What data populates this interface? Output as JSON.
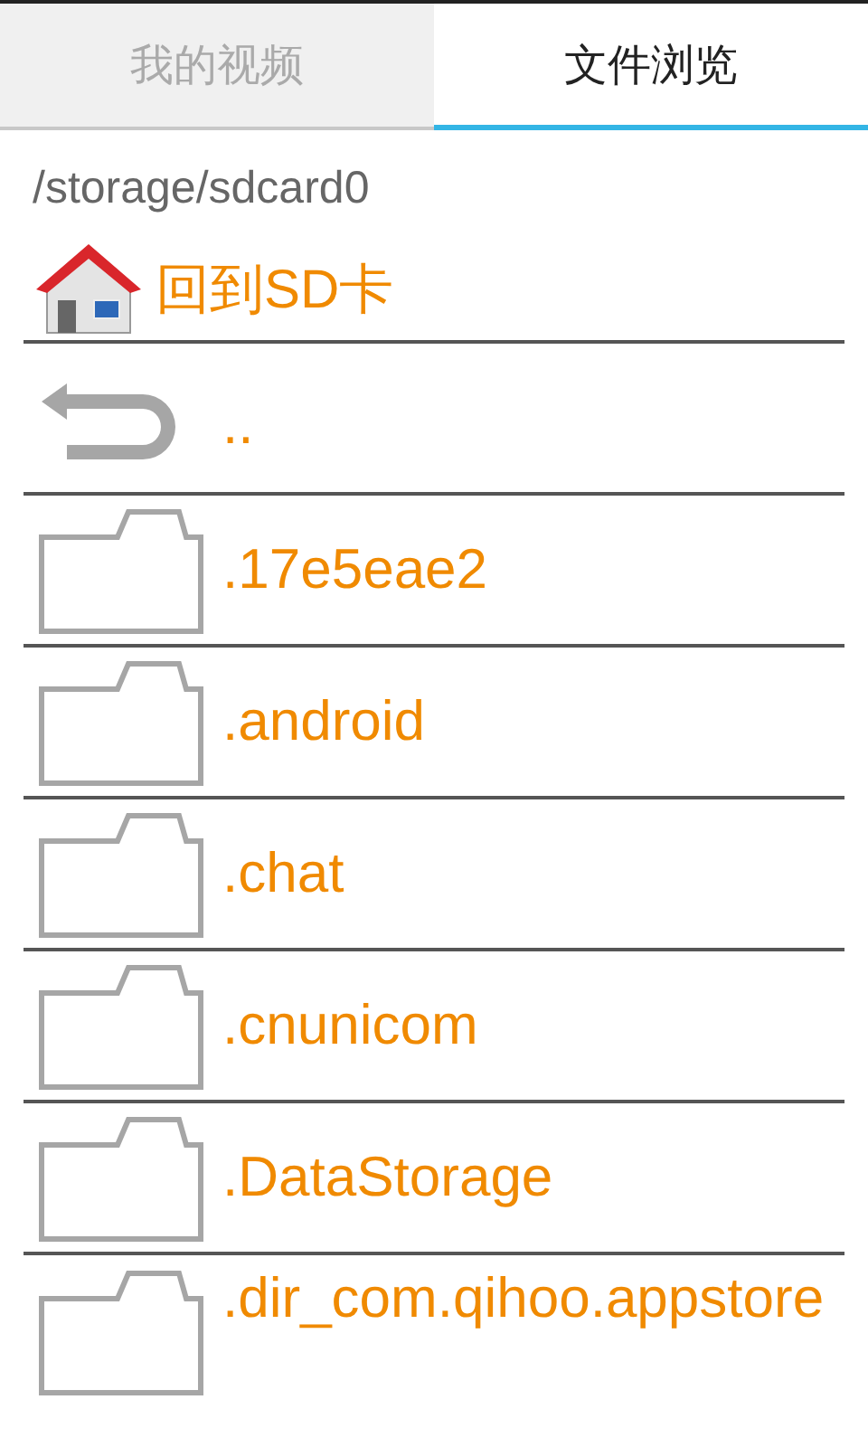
{
  "tabs": [
    {
      "label": "我的视频",
      "selected": false
    },
    {
      "label": "文件浏览",
      "selected": true
    }
  ],
  "path": "/storage/sdcard0",
  "home_link": {
    "label": "回到SD卡"
  },
  "entries": [
    {
      "kind": "up",
      "name": ".."
    },
    {
      "kind": "folder",
      "name": ".17e5eae2"
    },
    {
      "kind": "folder",
      "name": ".android"
    },
    {
      "kind": "folder",
      "name": ".chat"
    },
    {
      "kind": "folder",
      "name": ".cnunicom"
    },
    {
      "kind": "folder",
      "name": ".DataStorage"
    },
    {
      "kind": "folder",
      "name": ".dir_com.qihoo.appstore"
    }
  ]
}
